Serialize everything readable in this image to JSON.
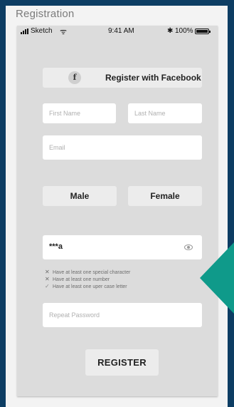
{
  "window": {
    "title": "Registration"
  },
  "status_bar": {
    "carrier": "Sketch",
    "time": "9:41 AM",
    "battery": "100%",
    "signal_icon": "signal-bars-icon",
    "wifi_icon": "wifi-icon",
    "bluetooth_icon": "bluetooth-icon",
    "battery_icon": "battery-icon"
  },
  "form": {
    "facebook_button": {
      "icon_text": "f",
      "label": "Register with Facebook"
    },
    "first_name": {
      "placeholder": "First Name"
    },
    "last_name": {
      "placeholder": "Last Name"
    },
    "email": {
      "placeholder": "Email"
    },
    "gender": {
      "male": "Male",
      "female": "Female"
    },
    "password": {
      "value": "***a"
    },
    "password_rules": [
      {
        "status": "fail",
        "mark": "✕",
        "text": "Have at least one special character"
      },
      {
        "status": "fail",
        "mark": "✕",
        "text": "Have at least one number"
      },
      {
        "status": "pass",
        "mark": "✓",
        "text": "Have at least one uper case letter"
      }
    ],
    "repeat_password": {
      "placeholder": "Repeat Password"
    },
    "register_button": "REGISTER"
  },
  "colors": {
    "background": "#0d3d63",
    "accent": "#0f9a8a",
    "phone": "#dcdcdc"
  }
}
